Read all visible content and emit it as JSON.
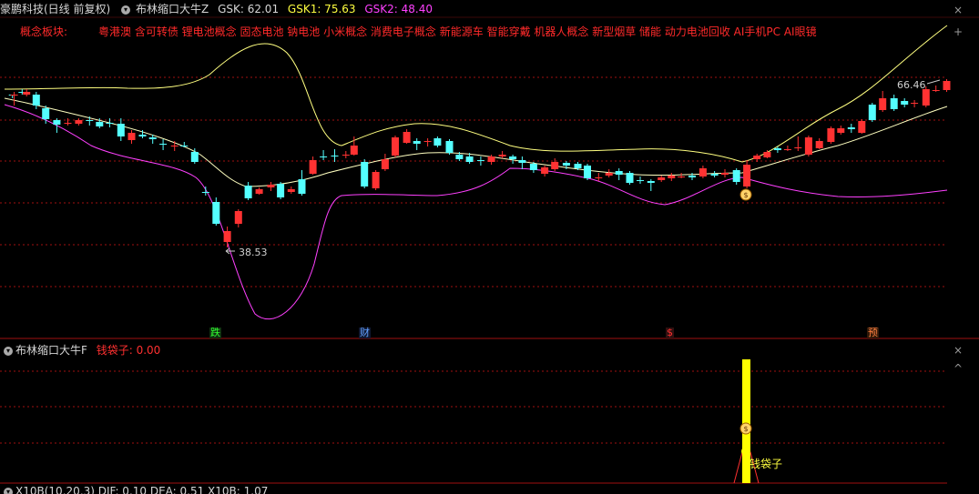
{
  "header": {
    "stock": "豪鹏科技(日线 前复权)",
    "indicator": "布林缩口大牛Z",
    "gsk": "GSK: 62.01",
    "gsk1": "GSK1: 75.63",
    "gsk2": "GSK2: 48.40"
  },
  "concepts": {
    "label": "概念板块:",
    "items": "粤港澳 含可转债 锂电池概念 固态电池 钠电池 小米概念 消费电子概念 新能源车 智能穿戴 机器人概念 新型烟草 储能 动力电池回收 AI手机PC AI眼镜"
  },
  "controls": {
    "close": "×",
    "plus": "+",
    "up": "^"
  },
  "price_labels": {
    "high": "66.46",
    "low": "38.53"
  },
  "markers": {
    "m1": "跌",
    "m2": "财",
    "m3": "$",
    "m4": "预"
  },
  "sub": {
    "indicator": "布林缩口大牛F",
    "value_label": "钱袋子: 0.00",
    "annotation": "钱袋子"
  },
  "bottom": {
    "text": "X10B(10,20,3) DIF: 0.10  DEA: 0.51  X10B: 1.07"
  },
  "colors": {
    "up": "#ff3232",
    "down": "#54ffff",
    "mid": "#ffff80",
    "upper": "#ffff80",
    "lower": "#ff40ff",
    "bar": "#ffff00"
  },
  "candles": [
    [
      13.7,
      104,
      104,
      104,
      108,
      "d"
    ],
    [
      15.6,
      105,
      104,
      101,
      116,
      "u"
    ],
    [
      24.3,
      102,
      101,
      98,
      104,
      "d"
    ],
    [
      29.2,
      101,
      104,
      98,
      106,
      "u"
    ],
    [
      39.8,
      104,
      116,
      101,
      120,
      "d"
    ],
    [
      50.2,
      119,
      131,
      116,
      136,
      "d"
    ],
    [
      62.4,
      132,
      137,
      130,
      146,
      "d"
    ],
    [
      74.5,
      136,
      135,
      130,
      138,
      "u"
    ],
    [
      86.4,
      136,
      132,
      130,
      138,
      "u"
    ],
    [
      98.3,
      132,
      133,
      128,
      138,
      "d"
    ],
    [
      109.3,
      134,
      139,
      130,
      141,
      "d"
    ],
    [
      120.4,
      135,
      136,
      130,
      140,
      "d"
    ],
    [
      132.8,
      136,
      150,
      130,
      155,
      "d"
    ],
    [
      144.5,
      154,
      146,
      143,
      158,
      "u"
    ],
    [
      156.5,
      148,
      150,
      143,
      152,
      "d"
    ],
    [
      167.7,
      151,
      153,
      148,
      158,
      "d"
    ],
    [
      179.1,
      158,
      158,
      153,
      165,
      "d"
    ],
    [
      191.7,
      161,
      160,
      155,
      166,
      "u"
    ],
    [
      202.3,
      160,
      161,
      156,
      162,
      "d"
    ],
    [
      213.8,
      167,
      178,
      163,
      180,
      "d"
    ],
    [
      225.8,
      211,
      212,
      205,
      215,
      "d"
    ],
    [
      237.3,
      222,
      246,
      217,
      248,
      "d"
    ],
    [
      249.6,
      266,
      254,
      249,
      272,
      "u"
    ],
    [
      261.8,
      246,
      232,
      230,
      250,
      "u"
    ],
    [
      272.6,
      204,
      218,
      200,
      220,
      "d"
    ],
    [
      284.6,
      213,
      208,
      206,
      214,
      "u"
    ],
    [
      297.5,
      206,
      203,
      200,
      210,
      "u"
    ],
    [
      308.1,
      202,
      217,
      200,
      219,
      "d"
    ],
    [
      319.8,
      211,
      208,
      205,
      213,
      "u"
    ],
    [
      331.5,
      213,
      197,
      187,
      215,
      "d"
    ],
    [
      343.6,
      191,
      176,
      172,
      192,
      "u"
    ],
    [
      355.1,
      173,
      172,
      165,
      176,
      "d"
    ],
    [
      367.5,
      172,
      171,
      164,
      178,
      "d"
    ],
    [
      379.8,
      171,
      170,
      166,
      174,
      "u"
    ],
    [
      388.8,
      170,
      160,
      150,
      171,
      "u"
    ],
    [
      400.2,
      178,
      205,
      175,
      207,
      "d"
    ],
    [
      412.6,
      207,
      189,
      187,
      209,
      "u"
    ],
    [
      422.9,
      186,
      175,
      169,
      188,
      "u"
    ],
    [
      434.0,
      171,
      151,
      149,
      173,
      "u"
    ],
    [
      446.6,
      157,
      145,
      142,
      158,
      "u"
    ],
    [
      457.7,
      155,
      158,
      152,
      165,
      "d"
    ],
    [
      469.6,
      156,
      155,
      152,
      161,
      "u"
    ],
    [
      480.4,
      152,
      160,
      150,
      162,
      "d"
    ],
    [
      493.5,
      155,
      168,
      153,
      170,
      "d"
    ],
    [
      504.4,
      170,
      175,
      167,
      177,
      "d"
    ],
    [
      515.6,
      172,
      178,
      168,
      180,
      "d"
    ],
    [
      527.9,
      176,
      177,
      172,
      182,
      "d"
    ],
    [
      539.6,
      178,
      172,
      170,
      181,
      "u"
    ],
    [
      551.6,
      172,
      170,
      166,
      174,
      "u"
    ],
    [
      563.1,
      172,
      175,
      170,
      180,
      "d"
    ],
    [
      573.4,
      176,
      179,
      172,
      186,
      "d"
    ],
    [
      585.9,
      180,
      187,
      178,
      190,
      "d"
    ],
    [
      598.1,
      191,
      184,
      182,
      194,
      "u"
    ],
    [
      609.2,
      186,
      178,
      174,
      188,
      "u"
    ],
    [
      621.9,
      179,
      182,
      177,
      186,
      "d"
    ],
    [
      634.5,
      180,
      185,
      178,
      187,
      "d"
    ],
    [
      645.0,
      182,
      196,
      180,
      198,
      "d"
    ],
    [
      657.3,
      195,
      196,
      190,
      199,
      "u"
    ],
    [
      668.7,
      193,
      190,
      186,
      195,
      "u"
    ],
    [
      679.7,
      188,
      192,
      185,
      198,
      "d"
    ],
    [
      691.5,
      190,
      201,
      188,
      203,
      "d"
    ],
    [
      703.0,
      198,
      199,
      194,
      202,
      "d"
    ],
    [
      714.8,
      199,
      201,
      197,
      210,
      "d"
    ],
    [
      726.2,
      198,
      195,
      193,
      200,
      "u"
    ],
    [
      737.3,
      196,
      193,
      190,
      199,
      "u"
    ],
    [
      748.1,
      195,
      194,
      190,
      196,
      "u"
    ],
    [
      760.0,
      193,
      195,
      190,
      198,
      "d"
    ],
    [
      771.9,
      194,
      185,
      182,
      196,
      "u"
    ],
    [
      784.6,
      191,
      193,
      188,
      195,
      "d"
    ],
    [
      796.0,
      192,
      190,
      186,
      195,
      "u"
    ],
    [
      808.7,
      187,
      200,
      185,
      203,
      "d"
    ],
    [
      820.1,
      205,
      181,
      176,
      207,
      "u"
    ],
    [
      831.2,
      175,
      171,
      169,
      178,
      "u"
    ],
    [
      842.4,
      173,
      167,
      165,
      174,
      "u"
    ],
    [
      853.9,
      165,
      163,
      161,
      168,
      "d"
    ],
    [
      864.9,
      165,
      164,
      160,
      166,
      "u"
    ],
    [
      876.3,
      163,
      162,
      150,
      166,
      "u"
    ],
    [
      887.9,
      170,
      151,
      149,
      172,
      "u"
    ],
    [
      899.7,
      163,
      155,
      152,
      164,
      "u"
    ],
    [
      912.4,
      156,
      141,
      139,
      158,
      "u"
    ],
    [
      923.3,
      146,
      141,
      138,
      148,
      "u"
    ],
    [
      934.8,
      140,
      142,
      136,
      146,
      "d"
    ],
    [
      946.3,
      146,
      133,
      131,
      147,
      "u"
    ],
    [
      957.8,
      132,
      115,
      113,
      134,
      "d"
    ],
    [
      969.2,
      121,
      108,
      100,
      123,
      "u"
    ],
    [
      981.7,
      120,
      108,
      104,
      122,
      "d"
    ],
    [
      993.2,
      115,
      111,
      108,
      118,
      "d"
    ],
    [
      1004.1,
      114,
      113,
      110,
      118,
      "u"
    ],
    [
      1016.8,
      116,
      98,
      95,
      118,
      "u"
    ],
    [
      1027.7,
      100,
      99,
      94,
      101,
      "u"
    ],
    [
      1039.5,
      99,
      89,
      87,
      101,
      "u"
    ]
  ]
}
